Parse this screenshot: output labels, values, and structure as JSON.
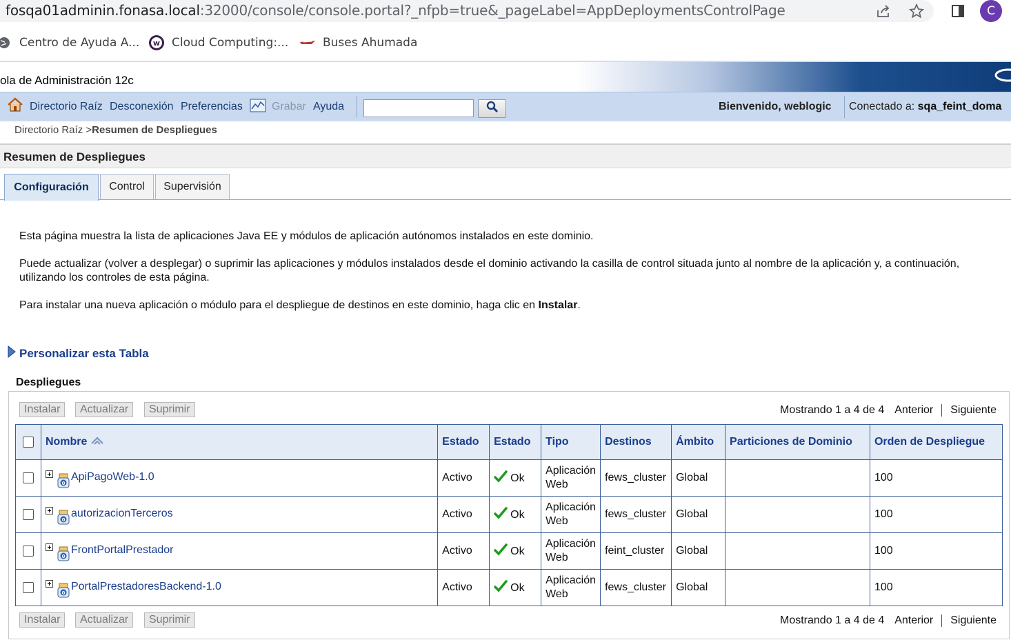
{
  "browser": {
    "url_host": "fosqa01adminin.fonasa.local",
    "url_rest": ":32000/console/console.portal?_nfpb=true&_pageLabel=AppDeploymentsControlPage",
    "avatar_letter": "C",
    "bookmarks": [
      "Centro de Ayuda A...",
      "Cloud Computing:...",
      "Buses Ahumada"
    ]
  },
  "header": {
    "title": "ola de Administración 12c",
    "toolbar": {
      "home": "Directorio Raíz",
      "logout": "Desconexión",
      "preferences": "Preferencias",
      "record": "Grabar",
      "help": "Ayuda",
      "search_value": ""
    },
    "welcome": "Bienvenido, weblogic",
    "connected_label": "Conectado a:",
    "connected_domain": "sqa_feint_doma"
  },
  "breadcrumb": {
    "root": "Directorio Raíz",
    "separator": ">",
    "current": "Resumen de Despliegues"
  },
  "page_title": "Resumen de Despliegues",
  "tabs": [
    "Configuración",
    "Control",
    "Supervisión"
  ],
  "description": {
    "p1": "Esta página muestra la lista de aplicaciones Java EE y módulos de aplicación autónomos instalados en este dominio.",
    "p2": "Puede actualizar (volver a desplegar) o suprimir las aplicaciones y módulos instalados desde el dominio activando la casilla de control situada junto al nombre de la aplicación y, a continuación, utilizando los controles de esta página.",
    "p3_prefix": "Para instalar una nueva aplicación o módulo para el despliegue de destinos en este dominio, haga clic en",
    "p3_bold": "Instalar",
    "p3_suffix": "."
  },
  "customize_label": "Personalizar esta Tabla",
  "table": {
    "caption": "Despliegues",
    "buttons": {
      "install": "Instalar",
      "update": "Actualizar",
      "delete": "Suprimir"
    },
    "pager": {
      "showing": "Mostrando 1 a 4 de 4",
      "previous": "Anterior",
      "next": "Siguiente"
    },
    "columns": [
      "Nombre",
      "Estado",
      "Estado",
      "Tipo",
      "Destinos",
      "Ámbito",
      "Particiones de Dominio",
      "Orden de Despliegue"
    ],
    "rows": [
      {
        "name": "ApiPagoWeb-1.0",
        "state": "Activo",
        "health": "Ok",
        "type": "Aplicación Web",
        "targets": "fews_cluster",
        "scope": "Global",
        "partitions": "",
        "order": "100"
      },
      {
        "name": "autorizacionTerceros",
        "state": "Activo",
        "health": "Ok",
        "type": "Aplicación Web",
        "targets": "fews_cluster",
        "scope": "Global",
        "partitions": "",
        "order": "100"
      },
      {
        "name": "FrontPortalPrestador",
        "state": "Activo",
        "health": "Ok",
        "type": "Aplicación Web",
        "targets": "feint_cluster",
        "scope": "Global",
        "partitions": "",
        "order": "100"
      },
      {
        "name": "PortalPrestadoresBackend-1.0",
        "state": "Activo",
        "health": "Ok",
        "type": "Aplicación Web",
        "targets": "fews_cluster",
        "scope": "Global",
        "partitions": "",
        "order": "100"
      }
    ]
  },
  "colors": {
    "accent": "#1a3d8a",
    "toolbar_bg": "#c9daf0",
    "header_bg": "#e2ebf6",
    "ok_green": "#1f9a1f"
  }
}
